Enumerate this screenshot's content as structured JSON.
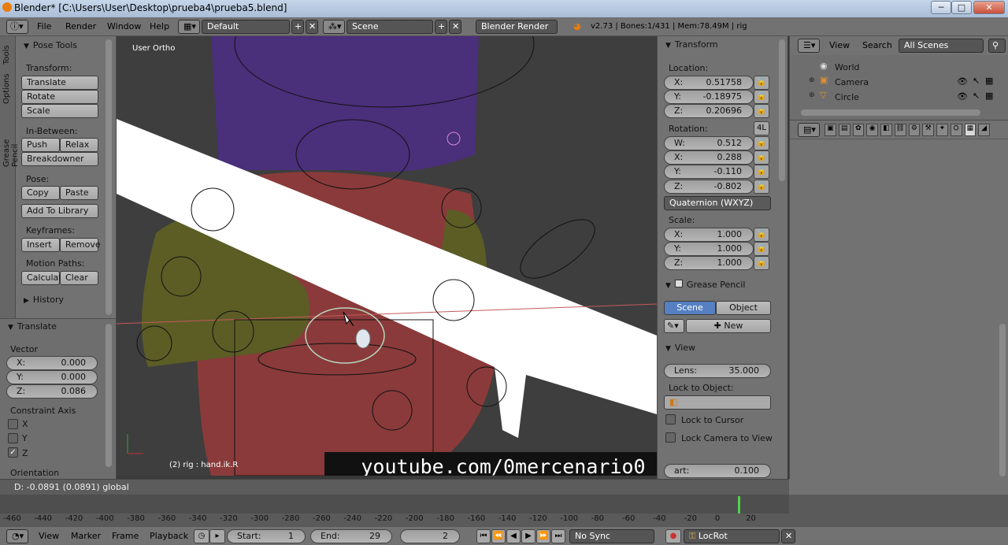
{
  "window": {
    "title": "Blender* [C:\\Users\\User\\Desktop\\prueba4\\prueba5.blend]",
    "min": "─",
    "max": "□",
    "close": "✕"
  },
  "menubar": {
    "items": [
      "File",
      "Render",
      "Window",
      "Help"
    ],
    "layout": "Default",
    "scene": "Scene",
    "engine": "Blender Render",
    "stats": "v2.73 | Bones:1/431 | Mem:78.49M | rig"
  },
  "tools": {
    "tabs": [
      "Tools",
      "Options",
      "Grease Pencil"
    ],
    "header": "Pose Tools",
    "transform_label": "Transform:",
    "translate": "Translate",
    "rotate": "Rotate",
    "scale": "Scale",
    "inbetween_label": "In-Between:",
    "push": "Push",
    "relax": "Relax",
    "breakdowner": "Breakdowner",
    "pose_label": "Pose:",
    "copy": "Copy",
    "paste": "Paste",
    "add_library": "Add To Library",
    "keyframes_label": "Keyframes:",
    "insert": "Insert",
    "remove": "Remove",
    "motion_label": "Motion Paths:",
    "calculate": "Calculat",
    "clear": "Clear",
    "history": "History"
  },
  "operator": {
    "header": "Translate",
    "vector_label": "Vector",
    "x_k": "X:",
    "x_v": "0.000",
    "y_k": "Y:",
    "y_v": "0.000",
    "z_k": "Z:",
    "z_v": "0.086",
    "constraint_label": "Constraint Axis",
    "cx": "X",
    "cy": "Y",
    "cz": "Z",
    "orientation": "Orientation"
  },
  "viewport": {
    "view_name": "User Ortho",
    "object_info": "(2) rig : hand.ik.R",
    "watermark": "youtube.com/0mercenario0"
  },
  "status": {
    "text": "D: -0.0891 (0.0891) global"
  },
  "properties": {
    "transform": "Transform",
    "location": "Location:",
    "lx": "0.51758",
    "ly": "-0.18975",
    "lz": "0.20696",
    "rotation": "Rotation:",
    "rot_mode_badge": "4L",
    "rw": "0.512",
    "rx": "0.288",
    "ry": "-0.110",
    "rz": "-0.802",
    "rot_mode": "Quaternion (WXYZ)",
    "scale_label": "Scale:",
    "sx": "1.000",
    "sy": "1.000",
    "sz": "1.000",
    "k_x": "X:",
    "k_y": "Y:",
    "k_z": "Z:",
    "k_w": "W:",
    "grease": "Grease Pencil",
    "gp_scene": "Scene",
    "gp_object": "Object",
    "gp_new": "New",
    "view": "View",
    "lens_k": "Lens:",
    "lens_v": "35.000",
    "lock_obj": "Lock to Object:",
    "lock_cursor": "Lock to Cursor",
    "lock_camera": "Lock Camera to View",
    "clip_start_k": "art:",
    "clip_start_v": "0.100"
  },
  "outliner": {
    "view": "View",
    "search": "Search",
    "filter": "All Scenes",
    "items": [
      "World",
      "Camera",
      "Circle"
    ]
  },
  "timeline": {
    "ticks": [
      "-460",
      "-440",
      "-420",
      "-400",
      "-380",
      "-360",
      "-340",
      "-320",
      "-300",
      "-280",
      "-260",
      "-240",
      "-220",
      "-200",
      "-180",
      "-160",
      "-140",
      "-120",
      "-100",
      "-80",
      "-60",
      "-40",
      "-20",
      "0",
      "20"
    ],
    "view": "View",
    "marker": "Marker",
    "frame": "Frame",
    "playback": "Playback",
    "start_k": "Start:",
    "start_v": "1",
    "end_k": "End:",
    "end_v": "29",
    "current": "2",
    "sync": "No Sync",
    "keying": "LocRot"
  },
  "colors": {
    "accent": "#5680c2",
    "viewport_bg": "#3d3d3d",
    "panel_bg": "#727272"
  }
}
